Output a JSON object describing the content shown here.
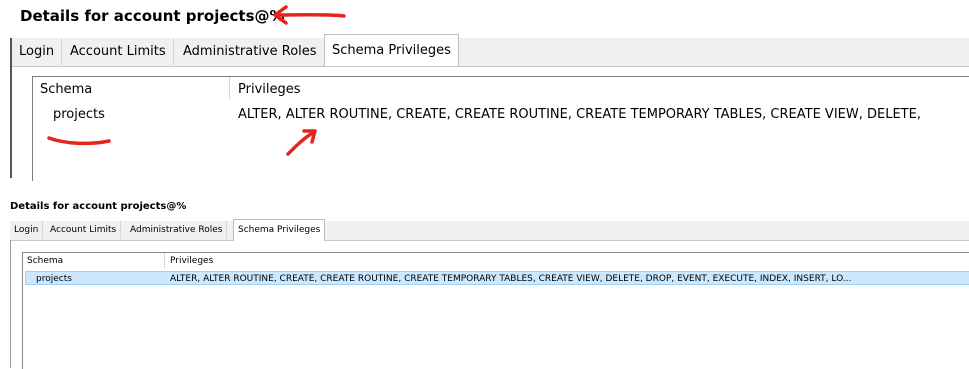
{
  "top": {
    "title": "Details for account projects@%",
    "tabs": [
      "Login",
      "Account Limits",
      "Administrative Roles",
      "Schema Privileges"
    ],
    "columns": [
      "Schema",
      "Privileges"
    ],
    "row": {
      "schema": "projects",
      "privileges": "ALTER, ALTER ROUTINE, CREATE, CREATE ROUTINE, CREATE TEMPORARY TABLES, CREATE VIEW, DELETE,"
    }
  },
  "bottom": {
    "title": "Details for account projects@%",
    "tabs": [
      "Login",
      "Account Limits",
      "Administrative Roles",
      "Schema Privileges"
    ],
    "columns": [
      "Schema",
      "Privileges"
    ],
    "row": {
      "schema": "projects",
      "privileges": "ALTER, ALTER ROUTINE, CREATE, CREATE ROUTINE, CREATE TEMPORARY TABLES, CREATE VIEW, DELETE, DROP, EVENT, EXECUTE, INDEX, INSERT, LO..."
    }
  },
  "colors": {
    "annotation": "#e8231b",
    "selection": "#cce8ff",
    "tab_bg": "#f0f0f0"
  }
}
